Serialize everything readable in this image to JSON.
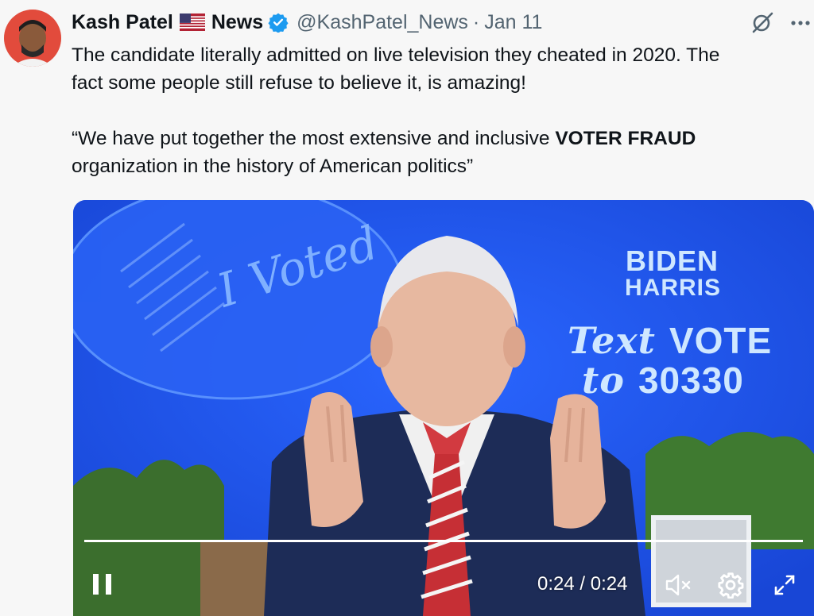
{
  "author": {
    "name": "Kash Patel",
    "flag_emoji": "🇺🇸",
    "name_suffix": "News",
    "handle": "@KashPatel_News",
    "separator": "·",
    "date": "Jan 11"
  },
  "tweet": {
    "line1": "The candidate literally admitted on live television they cheated in 2020. The",
    "line2": "fact some people still refuse to believe it, is amazing!",
    "quote_open": "“We have put together the most extensive and inclusive ",
    "quote_bold": "VOTER FRAUD",
    "quote_close": "organization in the history of American politics”"
  },
  "video": {
    "sign_line1": "BIDEN",
    "sign_line2": "HARRIS",
    "sign_text_word": "Text",
    "sign_vote_word": "VOTE",
    "sign_to_word": "to",
    "sign_number": "30330",
    "voted_sticker": "I Voted",
    "progress": 1.0,
    "time": "0:24 / 0:24"
  },
  "icons": {
    "grok": "grok-icon",
    "more": "more-icon",
    "pause": "pause-icon",
    "mute": "mute-icon",
    "settings": "gear-icon",
    "fullscreen": "fullscreen-icon"
  },
  "colors": {
    "background": "#f7f7f7",
    "verified": "#1d9bf0",
    "video_bg": "#1f56f0",
    "secondary_text": "#536471"
  }
}
